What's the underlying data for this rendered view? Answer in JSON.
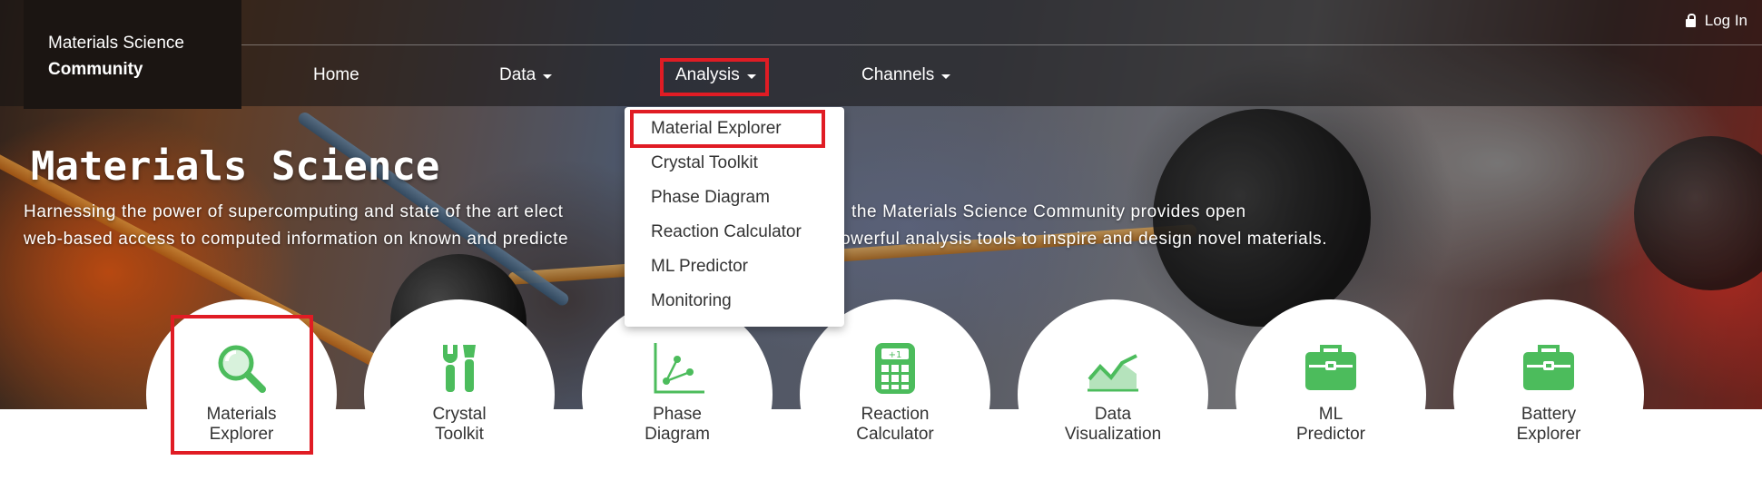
{
  "brand": {
    "line1": "Materials Science",
    "line2": "Community"
  },
  "login": {
    "label": "Log In",
    "icon": "lock-icon"
  },
  "nav": {
    "home": "Home",
    "data": "Data",
    "analysis": "Analysis",
    "channels": "Channels"
  },
  "analysis_menu": {
    "items": [
      "Material Explorer",
      "Crystal Toolkit",
      "Phase Diagram",
      "Reaction Calculator",
      "ML Predictor",
      "Monitoring"
    ]
  },
  "hero": {
    "title": "Materials Science",
    "desc_line1a": "Harnessing the power of supercomputing and state of the art elect",
    "desc_line1b": "the Materials Science Community provides open",
    "desc_line2a": "web-based access to computed information on known and predicte",
    "desc_line2b": "owerful analysis tools to inspire and design novel materials."
  },
  "apps": [
    {
      "line1": "Materials",
      "line2": "Explorer",
      "icon": "magnifier-icon"
    },
    {
      "line1": "Crystal",
      "line2": "Toolkit",
      "icon": "tools-icon"
    },
    {
      "line1": "Phase",
      "line2": "Diagram",
      "icon": "scatter-plot-icon"
    },
    {
      "line1": "Reaction",
      "line2": "Calculator",
      "icon": "calculator-icon"
    },
    {
      "line1": "Data",
      "line2": "Visualization",
      "icon": "area-chart-icon"
    },
    {
      "line1": "ML",
      "line2": "Predictor",
      "icon": "toolbox-icon"
    },
    {
      "line1": "Battery",
      "line2": "Explorer",
      "icon": "toolbox-icon"
    }
  ],
  "colors": {
    "accent_green": "#4cbc5c",
    "highlight_red": "#e01c24"
  }
}
